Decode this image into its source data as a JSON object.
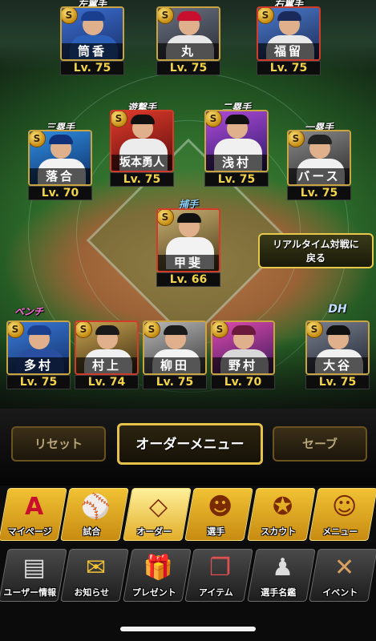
{
  "field_players": [
    {
      "id": "lf",
      "position": "左翼手",
      "name": "筒香",
      "level": "Lv. 75",
      "badge": "S",
      "cap": "#1b3f8f",
      "jersey": "#2c5fb8"
    },
    {
      "id": "cf",
      "position": "",
      "name": "丸",
      "level": "Lv. 75",
      "badge": "S",
      "cap": "#c8102e",
      "jersey": "#e8e8e8"
    },
    {
      "id": "rf",
      "position": "右翼手",
      "name": "福留",
      "level": "Lv. 75",
      "badge": "S",
      "cap": "#1a2a5a",
      "jersey": "#e9e9e9"
    },
    {
      "id": "ss",
      "position": "遊撃手",
      "name": "坂本勇人",
      "level": "Lv. 75",
      "badge": "S",
      "cap": "#111111",
      "jersey": "#ececec"
    },
    {
      "id": "2b",
      "position": "二塁手",
      "name": "浅村",
      "level": "Lv. 75",
      "badge": "S",
      "cap": "#111111",
      "jersey": "#f0f0f0"
    },
    {
      "id": "3b",
      "position": "三塁手",
      "name": "落合",
      "level": "Lv. 70",
      "badge": "S",
      "cap": "#10307a",
      "jersey": "#f2f2f2"
    },
    {
      "id": "1b",
      "position": "一塁手",
      "name": "バース",
      "level": "Lv. 75",
      "badge": "S",
      "cap": "#222222",
      "jersey": "#f0f0f0"
    },
    {
      "id": "c",
      "position": "捕手",
      "name": "甲斐",
      "level": "Lv. 66",
      "badge": "S",
      "cap": "#111111",
      "jersey": "#f2f2f2"
    }
  ],
  "bench_label": "ベンチ",
  "dh_label": "DH",
  "bench_players": [
    {
      "name": "多村",
      "level": "Lv. 75",
      "badge": "S",
      "cap": "#1b3f8f",
      "jersey": "#2a4fa0"
    },
    {
      "name": "村上",
      "level": "Lv. 74",
      "badge": "S",
      "cap": "#1a1a1a",
      "jersey": "#f0f0f0"
    },
    {
      "name": "柳田",
      "level": "Lv. 75",
      "badge": "S",
      "cap": "#1a1a1a",
      "jersey": "#f3f3f3"
    },
    {
      "name": "野村",
      "level": "Lv. 70",
      "badge": "S",
      "cap": "#6b1a3a",
      "jersey": "#d8d8d8"
    }
  ],
  "dh_player": {
    "name": "大谷",
    "level": "Lv. 75",
    "badge": "S",
    "cap": "#111111",
    "jersey": "#f0f0f0"
  },
  "return_button": {
    "line1": "リアルタイム対戦に",
    "line2": "戻る"
  },
  "commands": {
    "reset": "リセット",
    "order_menu": "オーダーメニュー",
    "save": "セーブ"
  },
  "main_menu": [
    {
      "label": "マイページ",
      "icon": "letter-a-icon",
      "glyph": "A"
    },
    {
      "label": "試合",
      "icon": "stadium-icon",
      "glyph": "⚾"
    },
    {
      "label": "オーダー",
      "icon": "field-diagram-icon",
      "glyph": "◇"
    },
    {
      "label": "選手",
      "icon": "player-silhouette-icon",
      "glyph": "☻"
    },
    {
      "label": "スカウト",
      "icon": "scout-badge-icon",
      "glyph": "✪"
    },
    {
      "label": "メニュー",
      "icon": "menu-mascot-icon",
      "glyph": "☺"
    }
  ],
  "sub_menu": [
    {
      "label": "ユーザー情報",
      "icon": "user-card-icon",
      "glyph": "▤"
    },
    {
      "label": "お知らせ",
      "icon": "notice-mascot-icon",
      "glyph": "✉"
    },
    {
      "label": "プレゼント",
      "icon": "gift-box-icon",
      "glyph": "🎁"
    },
    {
      "label": "アイテム",
      "icon": "item-book-icon",
      "glyph": "❐"
    },
    {
      "label": "選手名鑑",
      "icon": "player-directory-icon",
      "glyph": "♟"
    },
    {
      "label": "イベント",
      "icon": "bats-and-ball-icon",
      "glyph": "✕"
    }
  ],
  "colors": {
    "gold": "#e6c24a",
    "level_text": "#f2d34a",
    "catcher_label": "#8fd6ff",
    "bench_label": "#ff6bd8"
  }
}
